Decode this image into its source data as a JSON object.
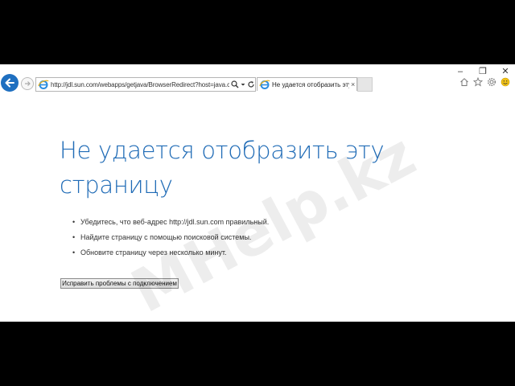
{
  "window": {
    "minimize": "–",
    "restore": "❐",
    "close": "✕"
  },
  "browser": {
    "address": "http://jdl.sun.com/webapps/getjava/BrowserRedirect?host=java.co",
    "tab_title": "Не удается отобразить эту...",
    "tab_close": "×"
  },
  "page": {
    "heading_line1": "Не удается отобразить эту",
    "heading_line2": "страницу",
    "bullets": [
      "Убедитесь, что веб-адрес http://jdl.sun.com правильный.",
      "Найдите страницу с помощью поисковой системы.",
      "Обновите страницу через несколько минут."
    ],
    "fix_button": "Исправить проблемы с подключением"
  },
  "watermark": "MHelp.kz",
  "colors": {
    "accent": "#1f6bb6",
    "back_button": "#1e6fc0",
    "letterbox": "#000000"
  }
}
